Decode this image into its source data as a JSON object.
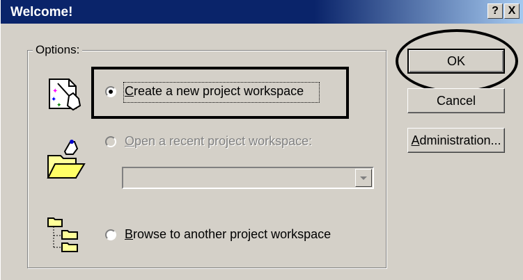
{
  "window": {
    "title": "Welcome!",
    "help_label": "?",
    "close_label": "X"
  },
  "options": {
    "legend": "Options:",
    "create": {
      "label_first": "C",
      "label_rest": "reate a new project workspace",
      "selected": true,
      "enabled": true
    },
    "open": {
      "label_first": "O",
      "label_rest": "pen a recent project workspace:",
      "selected": false,
      "enabled": false
    },
    "recent_combo": {
      "value": ""
    },
    "browse": {
      "label_first": "B",
      "label_rest": "rowse to another project workspace",
      "selected": false,
      "enabled": true
    }
  },
  "buttons": {
    "ok": "OK",
    "cancel": "Cancel",
    "admin_first": "A",
    "admin_rest": "dministration..."
  },
  "icons": {
    "create": "new-workspace-wand-icon",
    "open": "open-folder-hand-icon",
    "browse": "folder-tree-icon"
  },
  "colors": {
    "titlebar": "#0a246a",
    "face": "#d4d0c8"
  }
}
